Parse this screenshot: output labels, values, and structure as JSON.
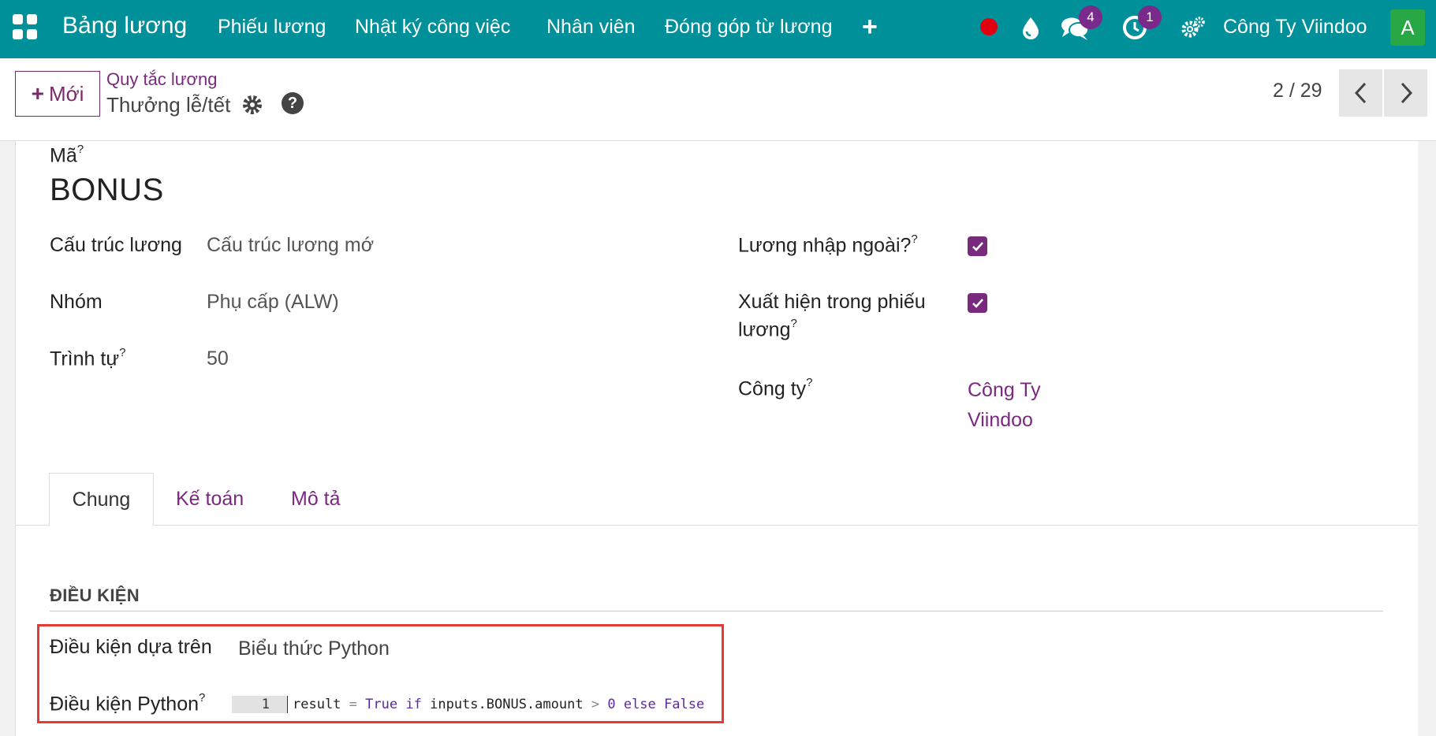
{
  "navbar": {
    "app_title": "Bảng lương",
    "menu_items": [
      "Phiếu lương",
      "Nhật ký công việc",
      "Nhân viên",
      "Đóng góp từ lương"
    ],
    "messages_count": "4",
    "activities_count": "1",
    "company": "Công Ty Viindoo",
    "avatar_letter": "A",
    "colors": {
      "bar": "#00909a",
      "badge": "#7a2a8a",
      "avatar": "#28a745"
    }
  },
  "control_panel": {
    "new_button": "Mới",
    "breadcrumb_parent": "Quy tắc lương",
    "record_name": "Thưởng lễ/tết",
    "pager": "2 / 29"
  },
  "form": {
    "code_label": "Mã",
    "code_value": "BONUS",
    "left_fields": [
      {
        "label": "Cấu trúc lương",
        "value": "Cấu trúc lương mớ",
        "help": ""
      },
      {
        "label": "Nhóm",
        "value": "Phụ cấp (ALW)",
        "help": ""
      },
      {
        "label": "Trình tự",
        "value": "50",
        "help": "?"
      }
    ],
    "right_fields": {
      "external_input_label": "Lương nhập ngoài?",
      "external_input_checked": true,
      "appears_on_payslip_label_1": "Xuất hiện trong phiếu",
      "appears_on_payslip_label_2": "lương",
      "appears_on_payslip_checked": true,
      "company_label": "Công ty",
      "company_value_1": "Công Ty",
      "company_value_2": "Viindoo"
    },
    "help_mark": "?"
  },
  "tabs": [
    "Chung",
    "Kế toán",
    "Mô tả"
  ],
  "conditions": {
    "section_title": "ĐIỀU KIỆN",
    "condition_based_on_label": "Điều kiện dựa trên",
    "condition_based_on_value": "Biểu thức Python",
    "python_condition_label": "Điều kiện Python",
    "code_line_number": "1",
    "code": "result = True if inputs.BONUS.amount > 0 else False"
  }
}
